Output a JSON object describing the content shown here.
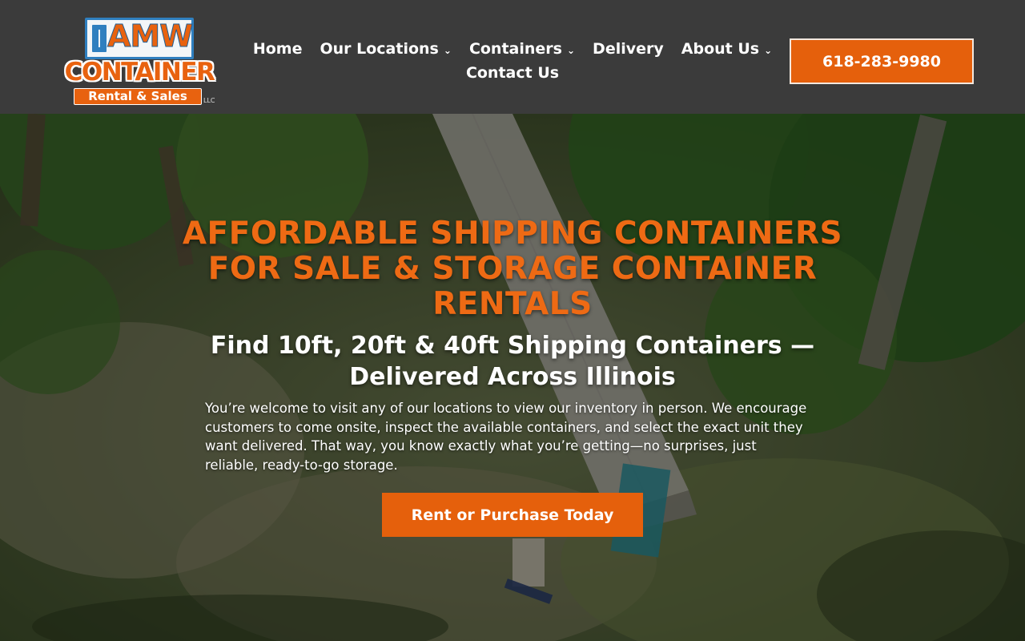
{
  "brand": {
    "logo_word_1": "AMW",
    "logo_word_2": "CONTAINER",
    "logo_tagline": "Rental & Sales",
    "logo_suffix": "LLC",
    "accent_color": "#e5600c",
    "header_color": "#3b3b3b"
  },
  "nav": {
    "items": [
      {
        "label": "Home",
        "has_dropdown": false
      },
      {
        "label": "Our Locations",
        "has_dropdown": true
      },
      {
        "label": "Containers",
        "has_dropdown": true
      },
      {
        "label": "Delivery",
        "has_dropdown": false
      },
      {
        "label": "About Us",
        "has_dropdown": true
      },
      {
        "label": "Contact Us",
        "has_dropdown": false
      }
    ],
    "dropdown_icon": "chevron-down-icon",
    "chevron": "⌄"
  },
  "header": {
    "phone_label": "618-283-9980"
  },
  "hero": {
    "title": "AFFORDABLE SHIPPING CONTAINERS FOR SALE & STORAGE CONTAINER RENTALS",
    "subtitle": "Find 10ft, 20ft & 40ft Shipping Containers — Delivered Across Illinois",
    "body": "You’re welcome to visit any of our locations to view our inventory in person. We encourage customers to come onsite, inspect the available containers, and select the exact unit they want delivered. That way, you know exactly what you’re getting—no surprises, just reliable, ready-to-go storage.",
    "cta_label": "Rent or Purchase Today"
  }
}
